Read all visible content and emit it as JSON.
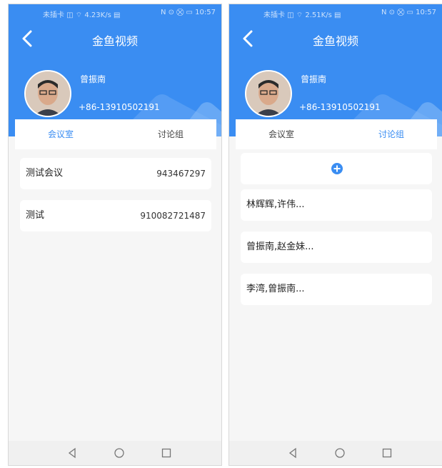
{
  "screens": [
    {
      "status": {
        "left": "未插卡 ◫ ⌔ 4.23K/s ▤",
        "right": "N ⊙ ⛒ ▭ 10:57"
      },
      "title": "金鱼视频",
      "user": {
        "name": "曾振南",
        "phone": "+86-13910502191"
      },
      "tabs": [
        {
          "label": "会议室"
        },
        {
          "label": "讨论组"
        }
      ],
      "active_tab": 0,
      "meetings": [
        {
          "name": "测试会议",
          "id": "943467297"
        },
        {
          "name": "测试",
          "id": "910082721487"
        }
      ]
    },
    {
      "status": {
        "left": "未插卡 ◫ ⌔ 2.51K/s ▤",
        "right": "N ⊙ ⛒ ▭ 10:57"
      },
      "title": "金鱼视频",
      "user": {
        "name": "曾振南",
        "phone": "+86-13910502191"
      },
      "tabs": [
        {
          "label": "会议室"
        },
        {
          "label": "讨论组"
        }
      ],
      "active_tab": 1,
      "groups": [
        {
          "name": "林辉辉,许伟..."
        },
        {
          "name": "曾振南,赵金妹..."
        },
        {
          "name": "李湾,曾振南..."
        }
      ]
    }
  ],
  "colors": {
    "primary": "#3a8df2",
    "background": "#f6f6f6",
    "card": "#ffffff"
  },
  "icons": {
    "back": "chevron-left-icon",
    "add": "plus-circle-icon",
    "nav": [
      "back-triangle-icon",
      "home-circle-icon",
      "recents-square-icon"
    ]
  }
}
